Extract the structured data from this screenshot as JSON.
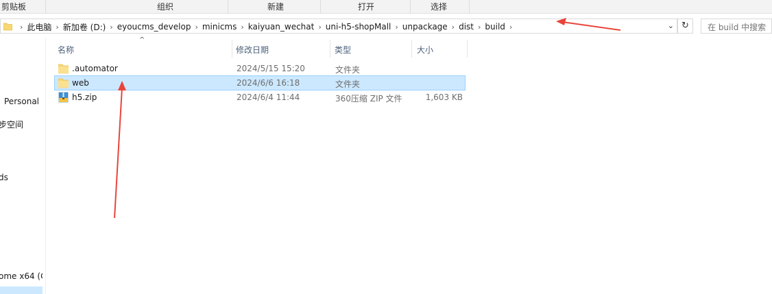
{
  "ribbon": {
    "groups": [
      "剪贴板",
      "组织",
      "新建",
      "打开",
      "选择"
    ]
  },
  "address": {
    "crumbs": [
      "此电脑",
      "新加卷 (D:)",
      "eyoucms_develop",
      "minicms",
      "kaiyuan_wechat",
      "uni-h5-shopMall",
      "unpackage",
      "dist",
      "build"
    ],
    "chevron": "›",
    "dropdown": "⌄",
    "refresh": "↻"
  },
  "search": {
    "placeholder": "在 build 中搜索"
  },
  "nav": {
    "items": [
      "Personal",
      "步空间",
      "ds",
      "ome x64 (C"
    ]
  },
  "columns": {
    "name": "名称",
    "date": "修改日期",
    "type": "类型",
    "size": "大小",
    "sort_indicator": "^"
  },
  "files": [
    {
      "name": ".automator",
      "date": "2024/5/15 15:20",
      "type": "文件夹",
      "size": "",
      "icon": "folder-icon",
      "selected": false
    },
    {
      "name": "web",
      "date": "2024/6/6 16:18",
      "type": "文件夹",
      "size": "",
      "icon": "folder-icon",
      "selected": true
    },
    {
      "name": "h5.zip",
      "date": "2024/6/4 11:44",
      "type": "360压缩 ZIP 文件",
      "size": "1,603 KB",
      "icon": "zip-archive-icon",
      "selected": false
    }
  ],
  "colors": {
    "folder": "#f8d775",
    "selection": "#cce8ff",
    "selection_border": "#99d1ff",
    "annotation_arrow": "#e8443a",
    "header_text": "#4c607a"
  }
}
